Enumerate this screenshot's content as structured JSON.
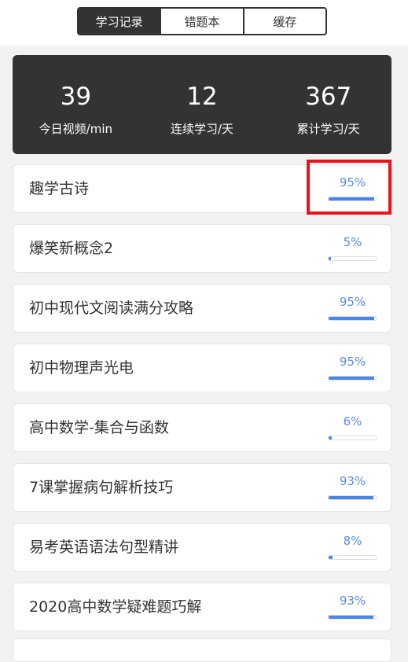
{
  "tabs": [
    {
      "label": "学习记录",
      "active": true
    },
    {
      "label": "错题本",
      "active": false
    },
    {
      "label": "缓存",
      "active": false
    }
  ],
  "stats": [
    {
      "value": "39",
      "label": "今日视频/min"
    },
    {
      "value": "12",
      "label": "连续学习/天"
    },
    {
      "value": "367",
      "label": "累计学习/天"
    }
  ],
  "courses": [
    {
      "title": "趣学古诗",
      "progress_text": "95%",
      "progress": 95
    },
    {
      "title": "爆笑新概念2",
      "progress_text": "5%",
      "progress": 5
    },
    {
      "title": "初中现代文阅读满分攻略",
      "progress_text": "95%",
      "progress": 95
    },
    {
      "title": "初中物理声光电",
      "progress_text": "95%",
      "progress": 95
    },
    {
      "title": "高中数学-集合与函数",
      "progress_text": "6%",
      "progress": 6
    },
    {
      "title": "7课掌握病句解析技巧",
      "progress_text": "93%",
      "progress": 93
    },
    {
      "title": "易考英语语法句型精讲",
      "progress_text": "8%",
      "progress": 8
    },
    {
      "title": "2020高中数学疑难题巧解",
      "progress_text": "93%",
      "progress": 93
    }
  ],
  "colors": {
    "accent": "#4a86e8",
    "dark": "#333333",
    "highlight": "#e8131c"
  }
}
